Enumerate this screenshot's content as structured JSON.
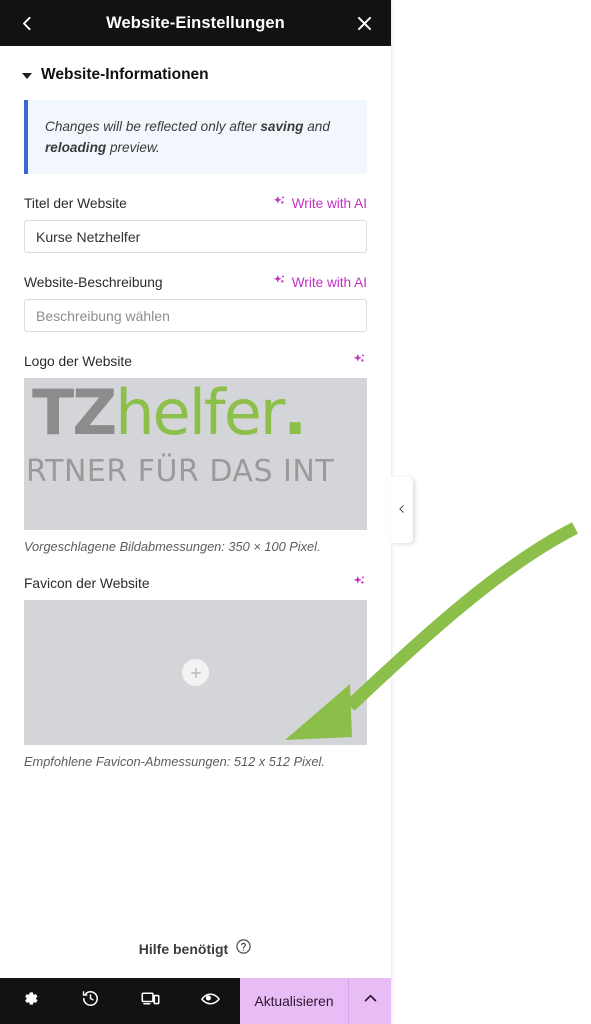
{
  "header": {
    "title": "Website-Einstellungen",
    "back_icon": "chevron-left-icon",
    "close_icon": "close-icon"
  },
  "section": {
    "title": "Website-Informationen",
    "caret_icon": "caret-down-icon"
  },
  "notice": {
    "part1": "Changes will be reflected only after ",
    "bold1": "saving",
    "part2": " and ",
    "bold2": "reloading",
    "part3": " preview.",
    "accent_color": "#3b66d4",
    "background_color": "#f2f7fd"
  },
  "fields": {
    "site_title": {
      "label": "Titel der Website",
      "ai_label": "Write with AI",
      "ai_icon": "sparkle-icon",
      "value": "Kurse Netzhelfer",
      "placeholder": ""
    },
    "site_description": {
      "label": "Website-Beschreibung",
      "ai_label": "Write with AI",
      "ai_icon": "sparkle-icon",
      "value": "",
      "placeholder": "Beschreibung wählen"
    },
    "site_logo": {
      "label": "Logo der Website",
      "ai_icon": "sparkle-icon",
      "hint": "Vorgeschlagene Bildabmessungen: 350 × 100 Pixel.",
      "image": {
        "word_gray": "TZ",
        "word_green": "helfer",
        "word_dot": ".",
        "tagline": "RTNER FÜR DAS INT",
        "gray_color": "#8c8c8c",
        "green_color": "#8cc04a",
        "background_color": "#d4d5d8"
      }
    },
    "site_favicon": {
      "label": "Favicon der Website",
      "ai_icon": "sparkle-icon",
      "hint": "Empfohlene Favicon-Abmessungen: 512 x 512 Pixel.",
      "upload_icon": "plus-icon",
      "background_color": "#d4d5d8"
    }
  },
  "help": {
    "label": "Hilfe benötigt",
    "icon": "question-mark-circle-icon"
  },
  "collapse_tab": {
    "icon": "chevron-left-icon"
  },
  "bottom_bar": {
    "icons": [
      {
        "name": "gear-icon",
        "label": "Einstellungen"
      },
      {
        "name": "history-icon",
        "label": "Verlauf"
      },
      {
        "name": "responsive-icon",
        "label": "Responsive"
      },
      {
        "name": "eye-icon",
        "label": "Vorschau"
      }
    ],
    "publish_label": "Aktualisieren",
    "caret_icon": "chevron-up-icon",
    "publish_color": "#e8bdf6",
    "background_color": "#121212"
  },
  "annotation": {
    "arrow_color": "#8cbf4a",
    "shape": "curved-arrow-pointing-down-left"
  }
}
